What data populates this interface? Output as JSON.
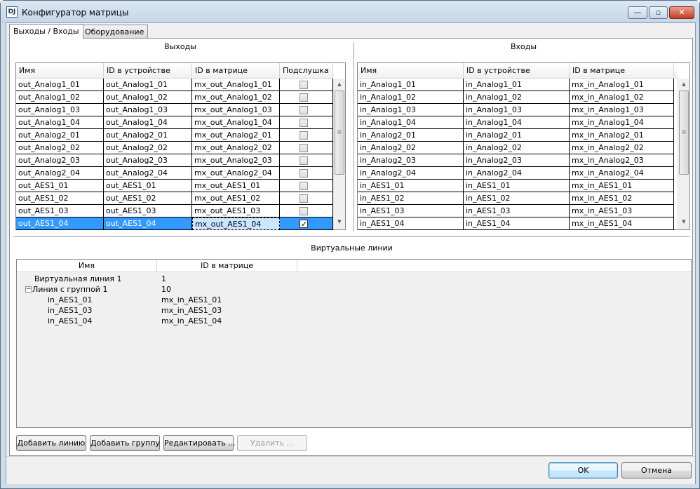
{
  "window": {
    "title": "Конфигуратор матрицы",
    "icon": "DJ"
  },
  "window_controls": {
    "minimize": "—",
    "maximize": "▫",
    "close": "✕"
  },
  "tabs": [
    {
      "label": "Выходы / Входы",
      "active": true
    },
    {
      "label": "Оборудование",
      "active": false
    }
  ],
  "outputs": {
    "title": "Выходы",
    "columns": [
      "Имя",
      "ID в устройстве",
      "ID в матрице",
      "Подслушка"
    ],
    "rows": [
      {
        "name": "out_Analog1_01",
        "device_id": "out_Analog1_01",
        "matrix_id": "mx_out_Analog1_01",
        "listen": false
      },
      {
        "name": "out_Analog1_02",
        "device_id": "out_Analog1_02",
        "matrix_id": "mx_out_Analog1_02",
        "listen": false
      },
      {
        "name": "out_Analog1_03",
        "device_id": "out_Analog1_03",
        "matrix_id": "mx_out_Analog1_03",
        "listen": false
      },
      {
        "name": "out_Analog1_04",
        "device_id": "out_Analog1_04",
        "matrix_id": "mx_out_Analog1_04",
        "listen": false
      },
      {
        "name": "out_Analog2_01",
        "device_id": "out_Analog2_01",
        "matrix_id": "mx_out_Analog2_01",
        "listen": false
      },
      {
        "name": "out_Analog2_02",
        "device_id": "out_Analog2_02",
        "matrix_id": "mx_out_Analog2_02",
        "listen": false
      },
      {
        "name": "out_Analog2_03",
        "device_id": "out_Analog2_03",
        "matrix_id": "mx_out_Analog2_03",
        "listen": false
      },
      {
        "name": "out_Analog2_04",
        "device_id": "out_Analog2_04",
        "matrix_id": "mx_out_Analog2_04",
        "listen": false
      },
      {
        "name": "out_AES1_01",
        "device_id": "out_AES1_01",
        "matrix_id": "mx_out_AES1_01",
        "listen": false
      },
      {
        "name": "out_AES1_02",
        "device_id": "out_AES1_02",
        "matrix_id": "mx_out_AES1_02",
        "listen": false
      },
      {
        "name": "out_AES1_03",
        "device_id": "out_AES1_03",
        "matrix_id": "mx_out_AES1_03",
        "listen": false
      },
      {
        "name": "out_AES1_04",
        "device_id": "out_AES1_04",
        "matrix_id": "mx_out_AES1_04",
        "listen": true,
        "selected": true
      }
    ]
  },
  "inputs": {
    "title": "Входы",
    "columns": [
      "Имя",
      "ID в устройстве",
      "ID в матрице"
    ],
    "rows": [
      {
        "name": "in_Analog1_01",
        "device_id": "in_Analog1_01",
        "matrix_id": "mx_in_Analog1_01"
      },
      {
        "name": "in_Analog1_02",
        "device_id": "in_Analog1_02",
        "matrix_id": "mx_in_Analog1_02"
      },
      {
        "name": "in_Analog1_03",
        "device_id": "in_Analog1_03",
        "matrix_id": "mx_in_Analog1_03"
      },
      {
        "name": "in_Analog1_04",
        "device_id": "in_Analog1_04",
        "matrix_id": "mx_in_Analog1_04"
      },
      {
        "name": "in_Analog2_01",
        "device_id": "in_Analog2_01",
        "matrix_id": "mx_in_Analog2_01"
      },
      {
        "name": "in_Analog2_02",
        "device_id": "in_Analog2_02",
        "matrix_id": "mx_in_Analog2_02"
      },
      {
        "name": "in_Analog2_03",
        "device_id": "in_Analog2_03",
        "matrix_id": "mx_in_Analog2_03"
      },
      {
        "name": "in_Analog2_04",
        "device_id": "in_Analog2_04",
        "matrix_id": "mx_in_Analog2_04"
      },
      {
        "name": "in_AES1_01",
        "device_id": "in_AES1_01",
        "matrix_id": "mx_in_AES1_01"
      },
      {
        "name": "in_AES1_02",
        "device_id": "in_AES1_02",
        "matrix_id": "mx_in_AES1_02"
      },
      {
        "name": "in_AES1_03",
        "device_id": "in_AES1_03",
        "matrix_id": "mx_in_AES1_03"
      },
      {
        "name": "in_AES1_04",
        "device_id": "in_AES1_04",
        "matrix_id": "mx_in_AES1_04"
      }
    ]
  },
  "virtual_lines": {
    "title": "Виртуальные линии",
    "columns": [
      "Имя",
      "ID в матрице"
    ],
    "items": [
      {
        "name": "Виртуальная линия 1",
        "matrix_id": "1",
        "level": 0
      },
      {
        "name": "Линия с группой 1",
        "matrix_id": "10",
        "level": 0,
        "expander": "−"
      },
      {
        "name": "in_AES1_01",
        "matrix_id": "mx_in_AES1_01",
        "level": 1
      },
      {
        "name": "in_AES1_03",
        "matrix_id": "mx_in_AES1_03",
        "level": 1
      },
      {
        "name": "in_AES1_04",
        "matrix_id": "mx_in_AES1_04",
        "level": 1
      }
    ]
  },
  "buttons": {
    "add_line": "Добавить линию",
    "add_group": "Добавить группу",
    "edit": "Редактировать ...",
    "delete": "Удалить ...",
    "ok": "OK",
    "cancel": "Отмена"
  },
  "scroll_glyphs": {
    "up": "▲",
    "down": "▼",
    "grip": "≡"
  }
}
